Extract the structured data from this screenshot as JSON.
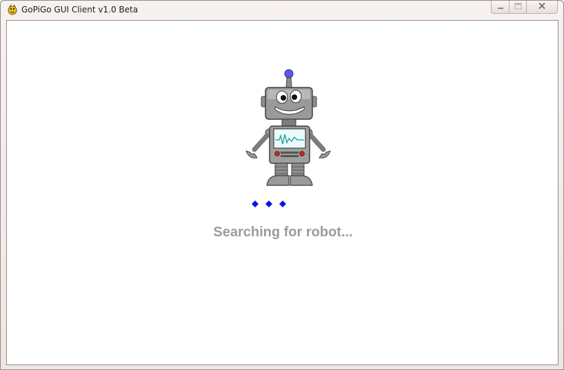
{
  "window": {
    "title": "GoPiGo GUI Client v1.0 Beta",
    "app_icon": "pygame-snake-icon",
    "controls": {
      "minimize_icon": "minimize-icon",
      "maximize_icon": "maximize-icon",
      "close_icon": "close-icon"
    }
  },
  "main": {
    "illustration": "robot-illustration",
    "loading_indicator": "three-blue-dots",
    "status": "Searching for robot..."
  },
  "colors": {
    "status_text": "#9c9c9c",
    "dots": "#0a14e6",
    "antenna_ball": "#5a5ae6"
  }
}
